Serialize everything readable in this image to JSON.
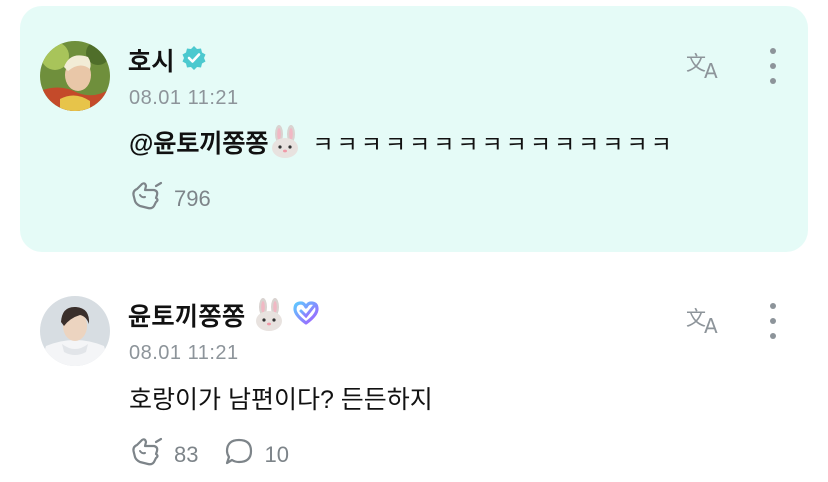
{
  "comments": [
    {
      "author": "호시",
      "time": "08.01 11:21",
      "mention": "@윤토끼쫑쫑",
      "text": "ㅋㅋㅋㅋㅋㅋㅋㅋㅋㅋㅋㅋㅋㅋㅋ",
      "likes": "796",
      "verified_badge": "verified-check-icon",
      "highlight_color": "#e5fbf7"
    },
    {
      "author": "윤토끼쫑쫑",
      "time": "08.01 11:21",
      "text": "호랑이가 남편이다? 든든하지",
      "likes": "83",
      "replies": "10",
      "badge": "heart-membership-icon"
    }
  ]
}
